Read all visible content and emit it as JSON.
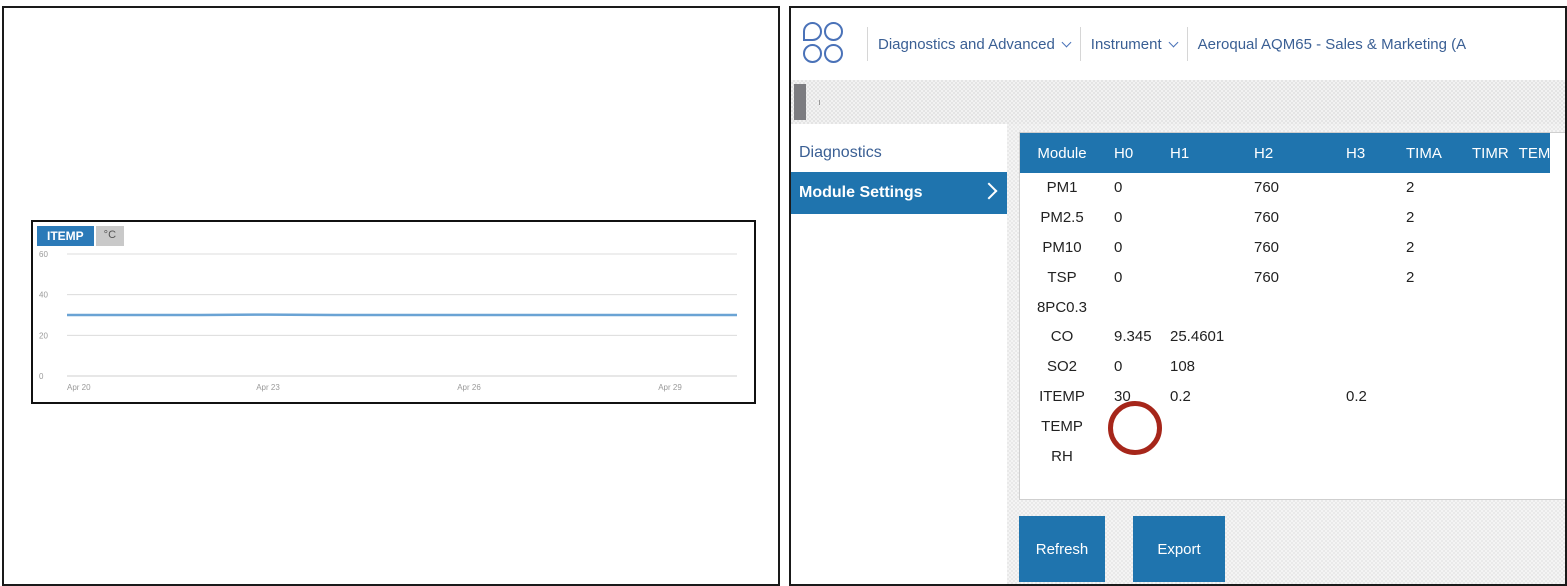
{
  "chart_data": {
    "type": "line",
    "title": "",
    "tab_label": "ITEMP",
    "unit_tab_label": "°C",
    "x_ticks": [
      "Apr 20",
      "Apr 23",
      "Apr 26",
      "Apr 29"
    ],
    "y_ticks": [
      0,
      20,
      40,
      60
    ],
    "ylim": [
      0,
      60
    ],
    "grid": true,
    "line_color": "#6aa3d4",
    "series": [
      {
        "x": [
          "Apr 20",
          "Apr 21",
          "Apr 22",
          "Apr 23",
          "Apr 24",
          "Apr 25",
          "Apr 26",
          "Apr 27",
          "Apr 28",
          "Apr 29",
          "Apr 30"
        ],
        "values": [
          30,
          30,
          30,
          30.2,
          30,
          30,
          30,
          30,
          30,
          30,
          30
        ]
      }
    ]
  },
  "app": {
    "nav": {
      "menu_diagnostics": "Diagnostics and Advanced",
      "menu_instrument": "Instrument",
      "instrument_name": "Aeroqual AQM65 - Sales & Marketing (A"
    },
    "sidebar": {
      "items": [
        {
          "label": "Diagnostics"
        },
        {
          "label": "Module Settings"
        }
      ]
    },
    "table": {
      "headers": [
        "Module",
        "H0",
        "H1",
        "H2",
        "H3",
        "TIMA",
        "TIMR",
        "TEM"
      ],
      "rows": [
        [
          "PM1",
          "0",
          "",
          "760",
          "",
          "2",
          "",
          ""
        ],
        [
          "PM2.5",
          "0",
          "",
          "760",
          "",
          "2",
          "",
          ""
        ],
        [
          "PM10",
          "0",
          "",
          "760",
          "",
          "2",
          "",
          ""
        ],
        [
          "TSP",
          "0",
          "",
          "760",
          "",
          "2",
          "",
          ""
        ],
        [
          "8PC0.3",
          "",
          "",
          "",
          "",
          "",
          "",
          ""
        ],
        [
          "CO",
          "9.345",
          "25.4601",
          "",
          "",
          "",
          "",
          ""
        ],
        [
          "SO2",
          "0",
          "108",
          "",
          "",
          "",
          "",
          ""
        ],
        [
          "ITEMP",
          "30",
          "0.2",
          "",
          "0.2",
          "",
          "",
          ""
        ],
        [
          "TEMP",
          "",
          "",
          "",
          "",
          "",
          "",
          ""
        ],
        [
          "RH",
          "",
          "",
          "",
          "",
          "",
          "",
          ""
        ]
      ]
    },
    "buttons": {
      "refresh": "Refresh",
      "export": "Export"
    },
    "colors": {
      "accent": "#1f74ae",
      "highlight_circle": "#a6261a"
    }
  }
}
